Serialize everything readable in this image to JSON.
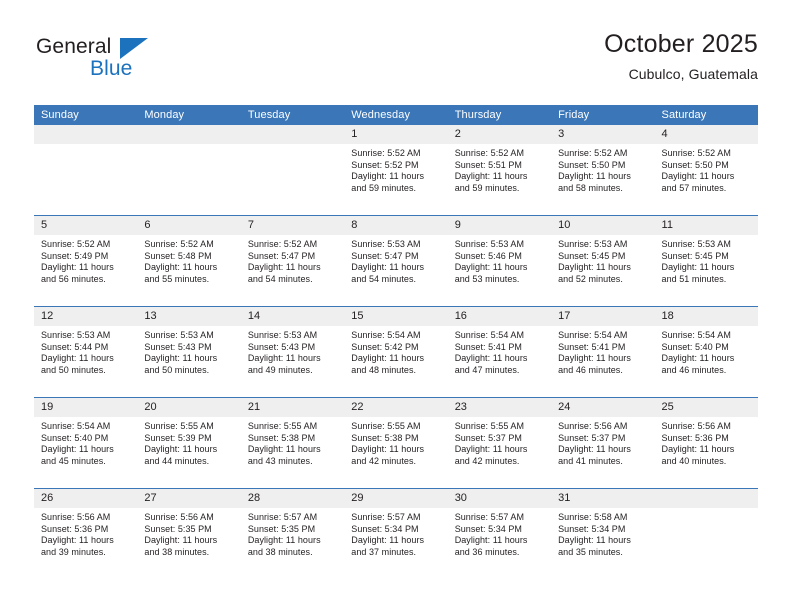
{
  "brand": {
    "word_one": "General",
    "word_two": "Blue",
    "triangle_icon": "triangle-icon",
    "accent_color": "#1c72bd"
  },
  "header": {
    "title": "October 2025",
    "subtitle": "Cubulco, Guatemala"
  },
  "calendar": {
    "header_background": "#3a76b8",
    "daynum_background": "#efefef",
    "weekday_headers": [
      "Sunday",
      "Monday",
      "Tuesday",
      "Wednesday",
      "Thursday",
      "Friday",
      "Saturday"
    ],
    "labels": {
      "sunrise_prefix": "Sunrise:",
      "sunset_prefix": "Sunset:",
      "daylight_prefix": "Daylight:"
    },
    "weeks": [
      [
        {
          "day": "",
          "empty": true
        },
        {
          "day": "",
          "empty": true
        },
        {
          "day": "",
          "empty": true
        },
        {
          "day": "1",
          "sunrise": "Sunrise: 5:52 AM",
          "sunset": "Sunset: 5:52 PM",
          "daylight": "Daylight: 11 hours and 59 minutes."
        },
        {
          "day": "2",
          "sunrise": "Sunrise: 5:52 AM",
          "sunset": "Sunset: 5:51 PM",
          "daylight": "Daylight: 11 hours and 59 minutes."
        },
        {
          "day": "3",
          "sunrise": "Sunrise: 5:52 AM",
          "sunset": "Sunset: 5:50 PM",
          "daylight": "Daylight: 11 hours and 58 minutes."
        },
        {
          "day": "4",
          "sunrise": "Sunrise: 5:52 AM",
          "sunset": "Sunset: 5:50 PM",
          "daylight": "Daylight: 11 hours and 57 minutes."
        }
      ],
      [
        {
          "day": "5",
          "sunrise": "Sunrise: 5:52 AM",
          "sunset": "Sunset: 5:49 PM",
          "daylight": "Daylight: 11 hours and 56 minutes."
        },
        {
          "day": "6",
          "sunrise": "Sunrise: 5:52 AM",
          "sunset": "Sunset: 5:48 PM",
          "daylight": "Daylight: 11 hours and 55 minutes."
        },
        {
          "day": "7",
          "sunrise": "Sunrise: 5:52 AM",
          "sunset": "Sunset: 5:47 PM",
          "daylight": "Daylight: 11 hours and 54 minutes."
        },
        {
          "day": "8",
          "sunrise": "Sunrise: 5:53 AM",
          "sunset": "Sunset: 5:47 PM",
          "daylight": "Daylight: 11 hours and 54 minutes."
        },
        {
          "day": "9",
          "sunrise": "Sunrise: 5:53 AM",
          "sunset": "Sunset: 5:46 PM",
          "daylight": "Daylight: 11 hours and 53 minutes."
        },
        {
          "day": "10",
          "sunrise": "Sunrise: 5:53 AM",
          "sunset": "Sunset: 5:45 PM",
          "daylight": "Daylight: 11 hours and 52 minutes."
        },
        {
          "day": "11",
          "sunrise": "Sunrise: 5:53 AM",
          "sunset": "Sunset: 5:45 PM",
          "daylight": "Daylight: 11 hours and 51 minutes."
        }
      ],
      [
        {
          "day": "12",
          "sunrise": "Sunrise: 5:53 AM",
          "sunset": "Sunset: 5:44 PM",
          "daylight": "Daylight: 11 hours and 50 minutes."
        },
        {
          "day": "13",
          "sunrise": "Sunrise: 5:53 AM",
          "sunset": "Sunset: 5:43 PM",
          "daylight": "Daylight: 11 hours and 50 minutes."
        },
        {
          "day": "14",
          "sunrise": "Sunrise: 5:53 AM",
          "sunset": "Sunset: 5:43 PM",
          "daylight": "Daylight: 11 hours and 49 minutes."
        },
        {
          "day": "15",
          "sunrise": "Sunrise: 5:54 AM",
          "sunset": "Sunset: 5:42 PM",
          "daylight": "Daylight: 11 hours and 48 minutes."
        },
        {
          "day": "16",
          "sunrise": "Sunrise: 5:54 AM",
          "sunset": "Sunset: 5:41 PM",
          "daylight": "Daylight: 11 hours and 47 minutes."
        },
        {
          "day": "17",
          "sunrise": "Sunrise: 5:54 AM",
          "sunset": "Sunset: 5:41 PM",
          "daylight": "Daylight: 11 hours and 46 minutes."
        },
        {
          "day": "18",
          "sunrise": "Sunrise: 5:54 AM",
          "sunset": "Sunset: 5:40 PM",
          "daylight": "Daylight: 11 hours and 46 minutes."
        }
      ],
      [
        {
          "day": "19",
          "sunrise": "Sunrise: 5:54 AM",
          "sunset": "Sunset: 5:40 PM",
          "daylight": "Daylight: 11 hours and 45 minutes."
        },
        {
          "day": "20",
          "sunrise": "Sunrise: 5:55 AM",
          "sunset": "Sunset: 5:39 PM",
          "daylight": "Daylight: 11 hours and 44 minutes."
        },
        {
          "day": "21",
          "sunrise": "Sunrise: 5:55 AM",
          "sunset": "Sunset: 5:38 PM",
          "daylight": "Daylight: 11 hours and 43 minutes."
        },
        {
          "day": "22",
          "sunrise": "Sunrise: 5:55 AM",
          "sunset": "Sunset: 5:38 PM",
          "daylight": "Daylight: 11 hours and 42 minutes."
        },
        {
          "day": "23",
          "sunrise": "Sunrise: 5:55 AM",
          "sunset": "Sunset: 5:37 PM",
          "daylight": "Daylight: 11 hours and 42 minutes."
        },
        {
          "day": "24",
          "sunrise": "Sunrise: 5:56 AM",
          "sunset": "Sunset: 5:37 PM",
          "daylight": "Daylight: 11 hours and 41 minutes."
        },
        {
          "day": "25",
          "sunrise": "Sunrise: 5:56 AM",
          "sunset": "Sunset: 5:36 PM",
          "daylight": "Daylight: 11 hours and 40 minutes."
        }
      ],
      [
        {
          "day": "26",
          "sunrise": "Sunrise: 5:56 AM",
          "sunset": "Sunset: 5:36 PM",
          "daylight": "Daylight: 11 hours and 39 minutes."
        },
        {
          "day": "27",
          "sunrise": "Sunrise: 5:56 AM",
          "sunset": "Sunset: 5:35 PM",
          "daylight": "Daylight: 11 hours and 38 minutes."
        },
        {
          "day": "28",
          "sunrise": "Sunrise: 5:57 AM",
          "sunset": "Sunset: 5:35 PM",
          "daylight": "Daylight: 11 hours and 38 minutes."
        },
        {
          "day": "29",
          "sunrise": "Sunrise: 5:57 AM",
          "sunset": "Sunset: 5:34 PM",
          "daylight": "Daylight: 11 hours and 37 minutes."
        },
        {
          "day": "30",
          "sunrise": "Sunrise: 5:57 AM",
          "sunset": "Sunset: 5:34 PM",
          "daylight": "Daylight: 11 hours and 36 minutes."
        },
        {
          "day": "31",
          "sunrise": "Sunrise: 5:58 AM",
          "sunset": "Sunset: 5:34 PM",
          "daylight": "Daylight: 11 hours and 35 minutes."
        },
        {
          "day": "",
          "empty": true
        }
      ]
    ]
  }
}
